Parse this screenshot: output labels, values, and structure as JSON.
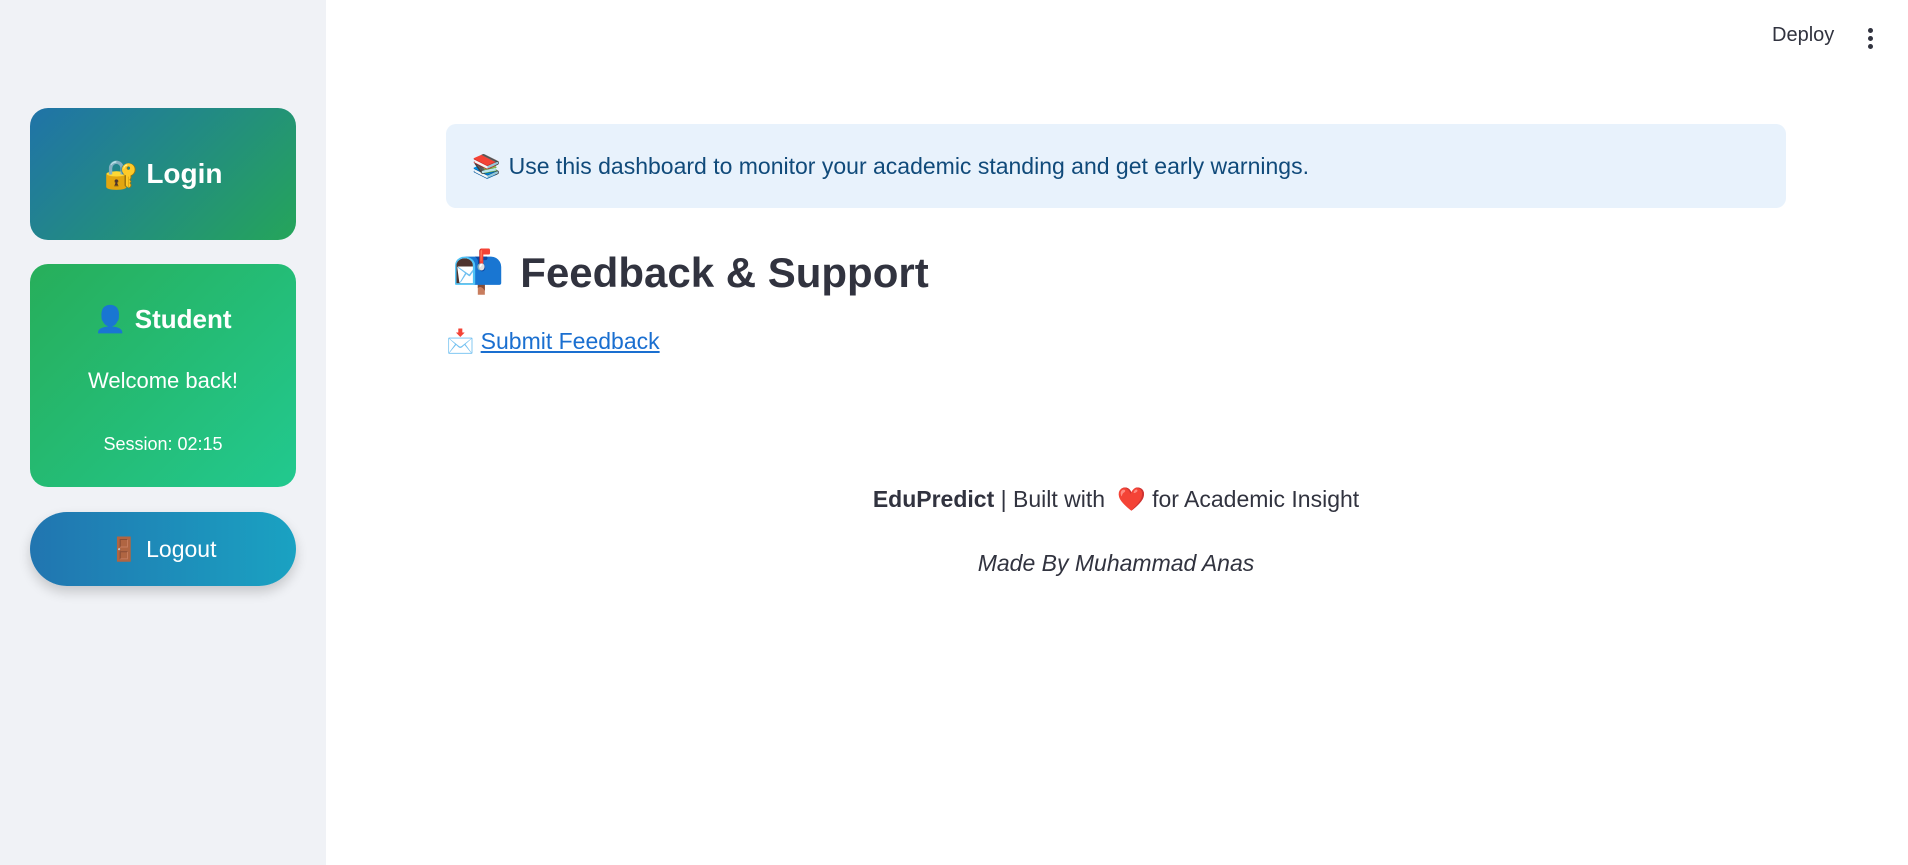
{
  "header": {
    "deploy_label": "Deploy"
  },
  "sidebar": {
    "login": {
      "icon": "🔐",
      "label": "Login"
    },
    "student": {
      "icon": "👤",
      "title": "Student",
      "welcome": "Welcome back!",
      "session": "Session: 02:15"
    },
    "logout": {
      "icon": "🚪",
      "label": "Logout"
    }
  },
  "main": {
    "info": {
      "icon": "📚",
      "text": "Use this dashboard to monitor your academic standing and get early warnings."
    },
    "heading": {
      "icon": "📬",
      "text": "Feedback & Support"
    },
    "feedback_link": {
      "icon": "📩",
      "text": "Submit Feedback"
    },
    "footer": {
      "brand": "EduPredict",
      "separator": " | Built with ",
      "heart": "❤️",
      "suffix": "for Academic Insight",
      "credit": "Made By Muhammad Anas"
    }
  },
  "colors": {
    "sidebar_bg": "#f0f2f6",
    "login_gradient": [
      "#2073a8",
      "#25a55a"
    ],
    "student_gradient": [
      "#27ae5a",
      "#22c98f"
    ],
    "logout_gradient": [
      "#2175b0",
      "#1aa2c2"
    ],
    "info_bg": "#e8f2fc",
    "link": "#1a6fd0"
  }
}
